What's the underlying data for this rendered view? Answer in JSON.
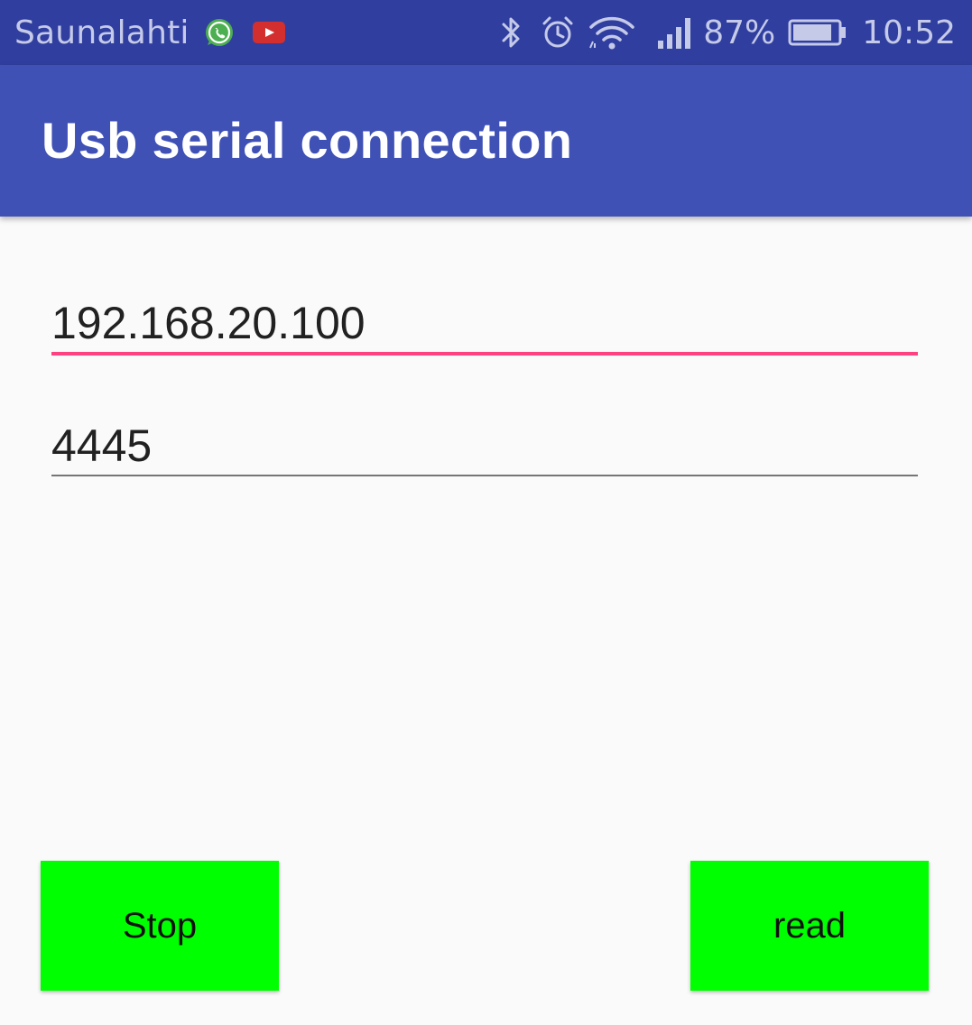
{
  "status_bar": {
    "carrier": "Saunalahti",
    "battery_percent": "87%",
    "battery_level": 0.87,
    "time": "10:52",
    "icons": [
      "whatsapp-icon",
      "youtube-icon",
      "bluetooth-icon",
      "alarm-icon",
      "wifi-icon",
      "signal-icon",
      "battery-icon"
    ]
  },
  "app_bar": {
    "title": "Usb serial connection"
  },
  "form": {
    "ip_value": "192.168.20.100",
    "port_value": "4445"
  },
  "buttons": {
    "stop_label": "Stop",
    "read_label": "read"
  },
  "colors": {
    "status_bar": "#303f9f",
    "app_bar": "#3f51b5",
    "accent": "#ff4081",
    "button": "#00ff00"
  }
}
